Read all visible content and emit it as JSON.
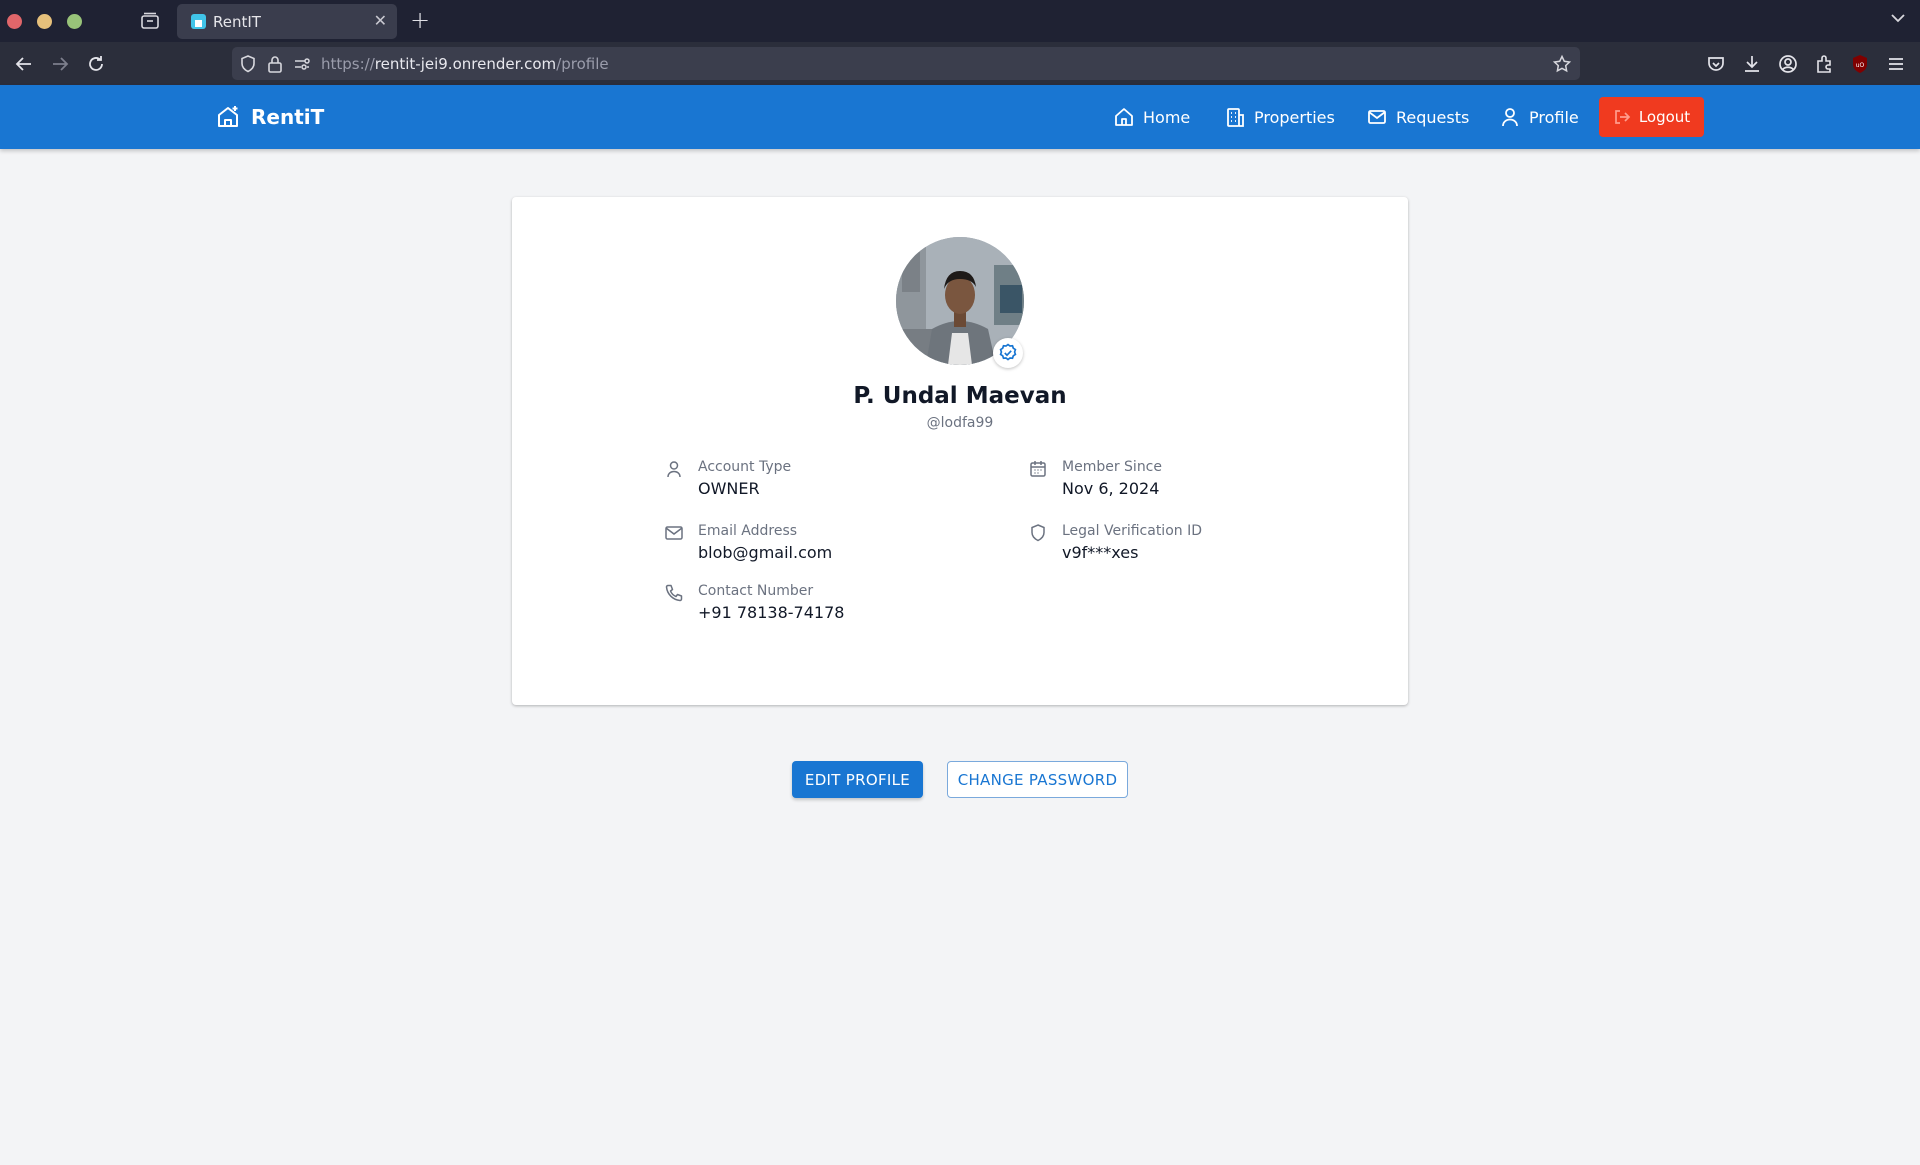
{
  "browser": {
    "tab_title": "RentIT",
    "url_prefix": "https://",
    "url_host": "rentit-jei9.onrender.com",
    "url_path": "/profile"
  },
  "header": {
    "brand": "RentiT",
    "nav": [
      {
        "label": "Home",
        "icon": "home-icon"
      },
      {
        "label": "Properties",
        "icon": "building-icon"
      },
      {
        "label": "Requests",
        "icon": "mail-icon"
      },
      {
        "label": "Profile",
        "icon": "user-icon"
      }
    ],
    "logout_label": "Logout",
    "accent_color": "#1976d2",
    "logout_color": "#f03a1f"
  },
  "profile": {
    "name": "P. Undal Maevan",
    "username": "@lodfa99",
    "verified": true,
    "fields": {
      "account_type": {
        "label": "Account Type",
        "value": "OWNER"
      },
      "member_since": {
        "label": "Member Since",
        "value": "Nov 6, 2024"
      },
      "email": {
        "label": "Email Address",
        "value": "blob@gmail.com"
      },
      "legal_id": {
        "label": "Legal Verification ID",
        "value": "v9f***xes"
      },
      "contact": {
        "label": "Contact Number",
        "value": "+91 78138-74178"
      }
    }
  },
  "actions": {
    "edit_label": "EDIT PROFILE",
    "password_label": "CHANGE PASSWORD"
  }
}
